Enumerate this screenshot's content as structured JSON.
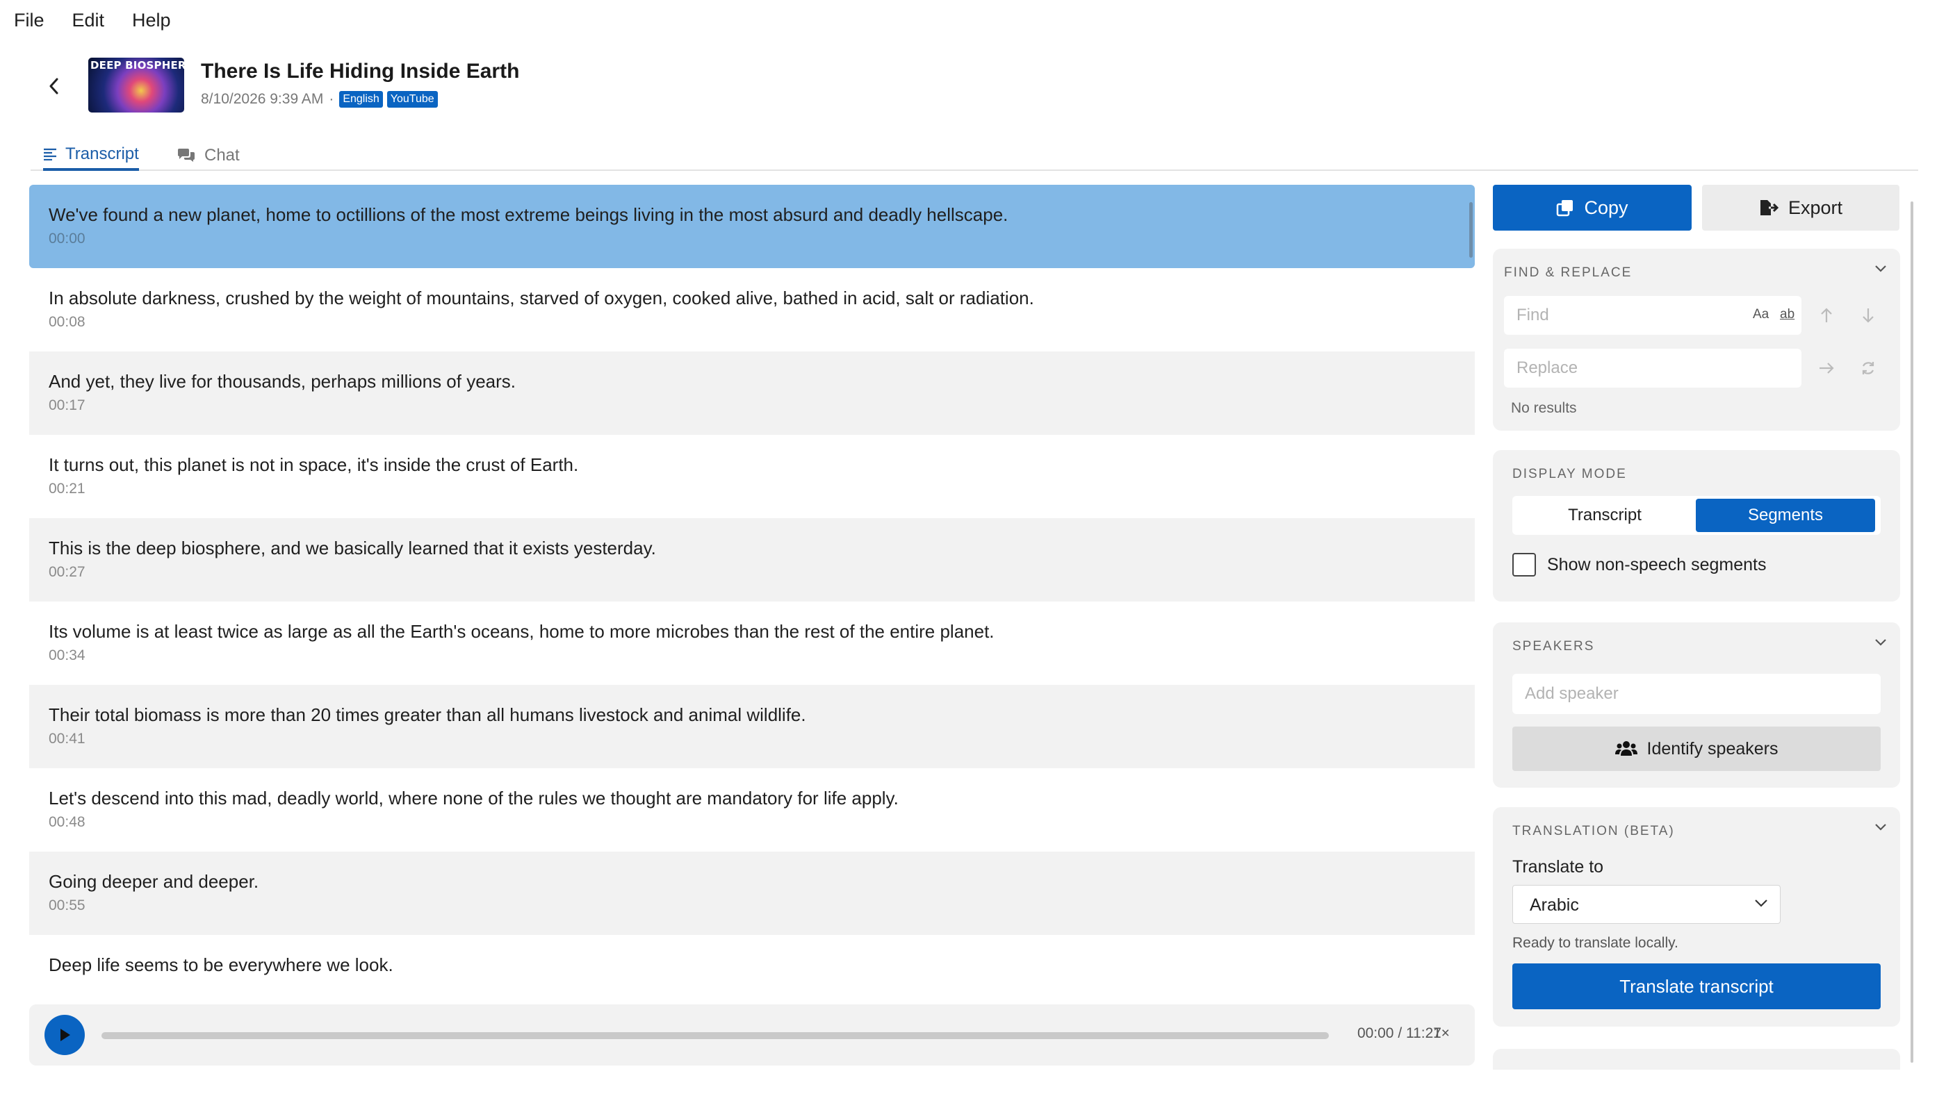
{
  "menu": {
    "file": "File",
    "edit": "Edit",
    "help": "Help"
  },
  "header": {
    "thumbnail_text": "DEEP BIOSPHERE",
    "title": "There Is Life Hiding Inside Earth",
    "date": "8/10/2026 9:39 AM",
    "separator": "·",
    "badges": [
      "English",
      "YouTube"
    ]
  },
  "tabs": [
    {
      "label": "Transcript",
      "icon": "list-icon",
      "active": true
    },
    {
      "label": "Chat",
      "icon": "chat-bubbles-icon",
      "active": false
    }
  ],
  "segments": [
    {
      "text": "We've found a new planet, home to octillions of the most extreme beings living in the most absurd and deadly hellscape.",
      "time": "00:00"
    },
    {
      "text": "In absolute darkness, crushed by the weight of mountains, starved of oxygen, cooked alive, bathed in acid, salt or radiation.",
      "time": "00:08"
    },
    {
      "text": "And yet, they live for thousands, perhaps millions of years.",
      "time": "00:17"
    },
    {
      "text": "It turns out, this planet is not in space, it's inside the crust of Earth.",
      "time": "00:21"
    },
    {
      "text": "This is the deep biosphere, and we basically learned that it exists yesterday.",
      "time": "00:27"
    },
    {
      "text": "Its volume is at least twice as large as all the Earth's oceans, home to more microbes than the rest of the entire planet.",
      "time": "00:34"
    },
    {
      "text": "Their total biomass is more than 20 times greater than all humans livestock and animal wildlife.",
      "time": "00:41"
    },
    {
      "text": "Let's descend into this mad, deadly world, where none of the rules we thought are mandatory for life apply.",
      "time": "00:48"
    },
    {
      "text": "Going deeper and deeper.",
      "time": "00:55"
    },
    {
      "text": "Deep life seems to be everywhere we look.",
      "time": ""
    }
  ],
  "player": {
    "time": "00:00 / 11:27",
    "speed": "1×",
    "progress": 0
  },
  "actions": {
    "copy": "Copy",
    "export": "Export"
  },
  "find_replace": {
    "title": "FIND & REPLACE",
    "find_placeholder": "Find",
    "replace_placeholder": "Replace",
    "match_case": "Aa",
    "whole_word": "ab",
    "status": "No results"
  },
  "display_mode": {
    "title": "DISPLAY MODE",
    "options": [
      "Transcript",
      "Segments"
    ],
    "selected": "Segments",
    "checkbox_label": "Show non-speech segments",
    "checked": false
  },
  "speakers": {
    "title": "SPEAKERS",
    "add_placeholder": "Add speaker",
    "identify_label": "Identify speakers"
  },
  "translation": {
    "title": "TRANSLATION (BETA)",
    "translate_to_label": "Translate to",
    "language": "Arabic",
    "status": "Ready to translate locally.",
    "button": "Translate transcript"
  },
  "colors": {
    "accent": "#0a64c2",
    "active_segment": "#82b8e6",
    "alt_row": "#f2f2f2"
  }
}
